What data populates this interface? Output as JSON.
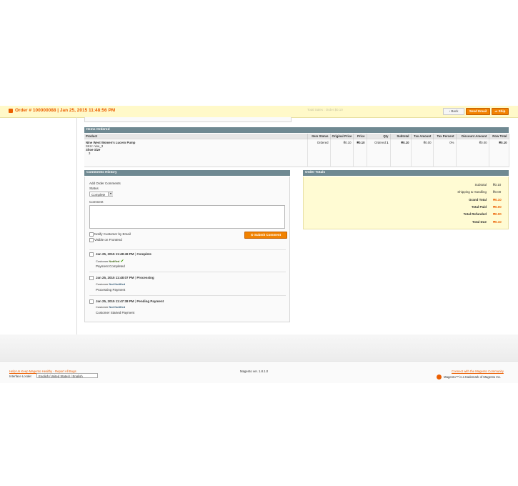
{
  "header": {
    "order_title": "Order # 100000088 | Jan 25, 2015 11:48:56 PM",
    "faded_text": "Total Sales : Order $0.10",
    "back_label": "Back",
    "send_email_label": "Send Email",
    "ship_label": "Ship"
  },
  "items_section": {
    "title": "Items Ordered",
    "columns": [
      "Product",
      "Item Status",
      "Original Price",
      "Price",
      "Qty",
      "Subtotal",
      "Tax Amount",
      "Tax Percent",
      "Discount Amount",
      "Row Total"
    ],
    "rows": [
      {
        "product_name": "Nine West Women's Lucero Pump",
        "sku": "SKU: nine_3",
        "option_label": "Shoe Size",
        "option_value": "3",
        "item_status": "Ordered",
        "original_price": "₴0.10",
        "price": "₴0.10",
        "qty": "Ordered",
        "qty_num": "1",
        "subtotal": "₴0.10",
        "tax_amount": "₴0.00",
        "tax_percent": "0%",
        "discount_amount": "₴0.00",
        "row_total": "₴0.10"
      }
    ]
  },
  "comments_section": {
    "title": "Comments History",
    "add_label": "Add Order Comments",
    "status_label": "Status",
    "status_value": "Complete",
    "comment_label": "Comment",
    "notify_label": "Notify Customer by Email",
    "visible_label": "Visible on Frontend",
    "submit_label": "Submit Comment",
    "history": [
      {
        "date": "Jan 25, 2015 11:48:49 PM",
        "status": "Complete",
        "customer_label": "Customer",
        "notified": "Notified",
        "note": "Payment Completed"
      },
      {
        "date": "Jan 25, 2015 11:48:07 PM",
        "status": "Processing",
        "customer_label": "Customer",
        "notified": "Not Notified",
        "note": "Processing Payment"
      },
      {
        "date": "Jan 25, 2015 11:47:38 PM",
        "status": "Pending Payment",
        "customer_label": "Customer",
        "notified": "Not Notified",
        "note": "Customer Started Payment"
      }
    ],
    "separator": "|"
  },
  "totals_section": {
    "title": "Order Totals",
    "rows": [
      {
        "label": "Subtotal",
        "value": "₴0.10"
      },
      {
        "label": "Shipping & Handling",
        "value": "₴0.00"
      },
      {
        "label": "Grand Total",
        "value": "₴0.10"
      },
      {
        "label": "Total Paid",
        "value": "₴0.00"
      },
      {
        "label": "Total Refunded",
        "value": "₴0.00"
      },
      {
        "label": "Total Due",
        "value": "₴0.10"
      }
    ]
  },
  "footer": {
    "help_link": "Help Us Keep Magento Healthy - Report All Bugs",
    "version": "Magento ver. 1.8.1.0",
    "community_link": "Connect with the Magento Community",
    "locale_label": "Interface Locale:",
    "locale_value": "English (United States) / English",
    "trademark": "Magento™ is a trademark of Magento Inc."
  },
  "colors": {
    "accent": "#eb5e00",
    "header_bg": "#fff9c9",
    "section_head": "#6f8992",
    "totals_bg": "#fffbd3"
  }
}
